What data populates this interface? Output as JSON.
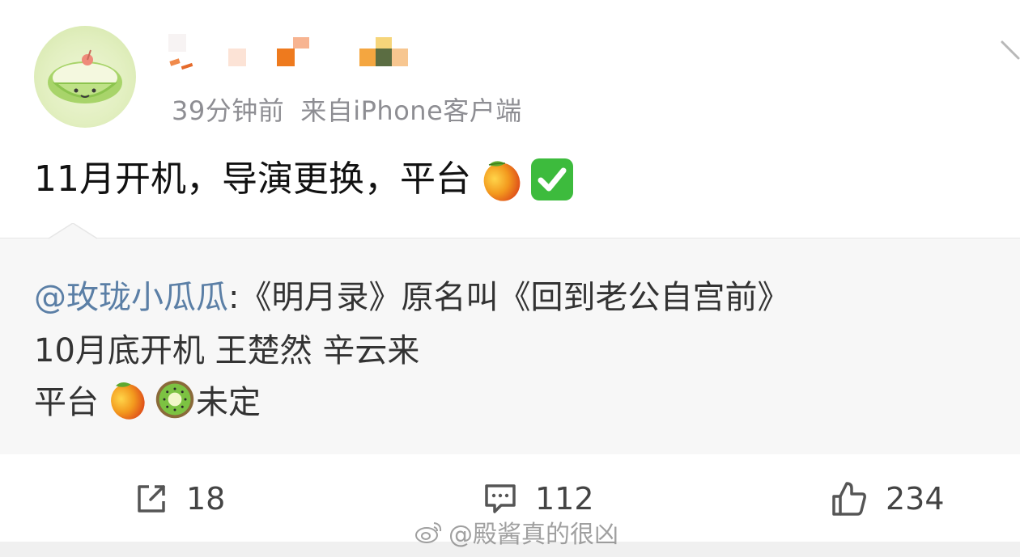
{
  "post": {
    "timestamp": "39分钟前",
    "source": "来自iPhone客户端",
    "text": "11月开机，导演更换，平台",
    "text_emojis": [
      "mango-emoji",
      "check-mark-emoji"
    ]
  },
  "repost": {
    "mention": "@玫珑小瓜瓜",
    "line1_rest": ":《明月录》原名叫《回到老公自宫前》",
    "line2": "10月底开机 王楚然 辛云来",
    "line3_prefix": "平台",
    "line3_emojis": [
      "mango-emoji",
      "kiwi-emoji"
    ],
    "line3_suffix": "未定"
  },
  "actions": {
    "repost_count": "18",
    "comment_count": "112",
    "like_count": "234"
  },
  "watermark": {
    "text": "@殿酱真的很凶"
  },
  "colors": {
    "mention": "#5b7fa6",
    "meta_gray": "#8e8e93",
    "repost_bg": "#f7f7f7",
    "check_green": "#3dbb3d"
  }
}
